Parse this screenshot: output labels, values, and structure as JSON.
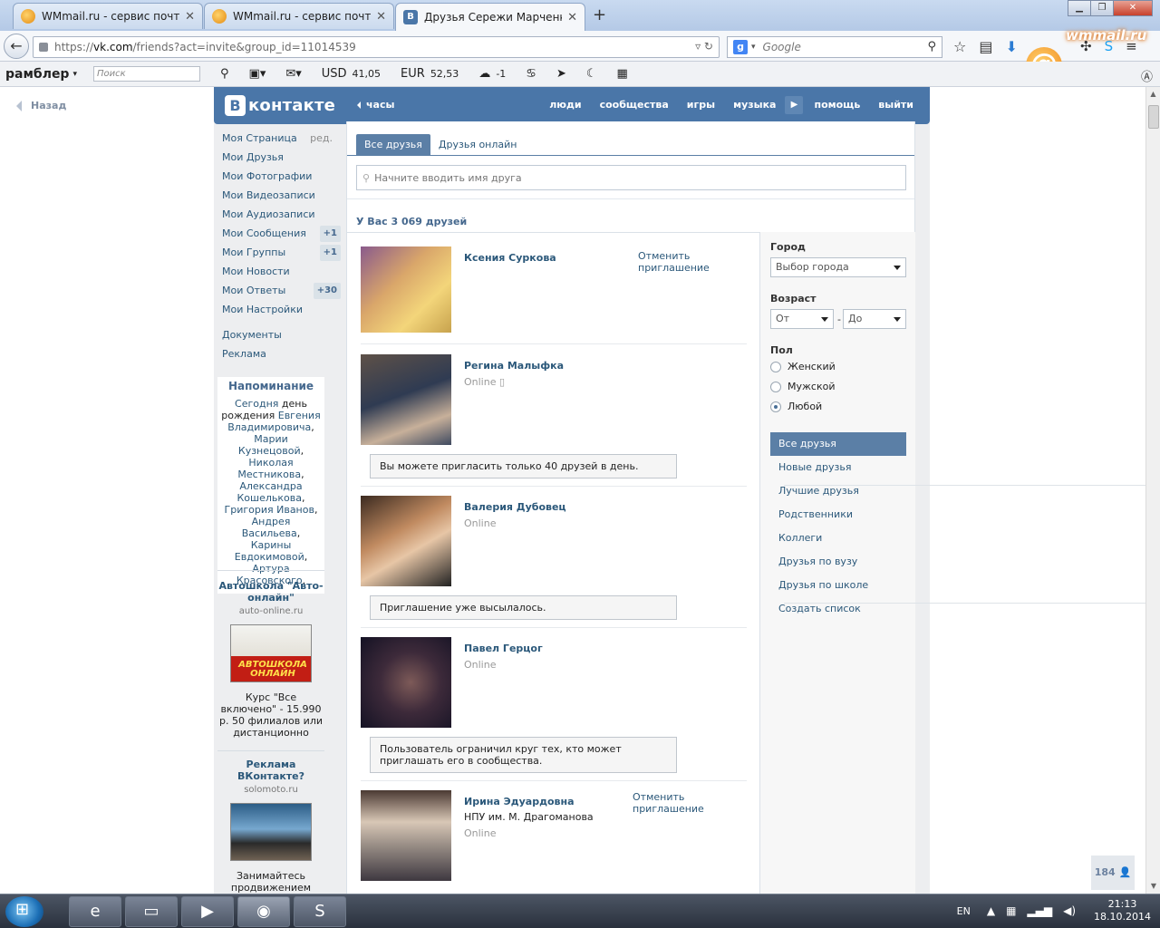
{
  "browser": {
    "tabs": [
      {
        "title": "WMmail.ru - сервис почт..."
      },
      {
        "title": "WMmail.ru - сервис почт..."
      },
      {
        "title": "Друзья Сережи Марченк..."
      }
    ],
    "url_prefix": "https://",
    "url_domain": "vk.com",
    "url_path": "/friends?act=invite&group_id=11014539",
    "search_placeholder": "Google",
    "wm_logo": "wmmail.ru"
  },
  "rambler": {
    "brand": "рамблер",
    "search_placeholder": "Поиск",
    "usd_label": "USD",
    "usd_value": "41,05",
    "eur_label": "EUR",
    "eur_value": "52,53",
    "weather": "-1"
  },
  "page": {
    "back_label": "Назад"
  },
  "vk": {
    "logo_letter": "В",
    "logo_text": "контакте",
    "back_label": "часы",
    "menu": [
      "люди",
      "сообщества",
      "игры",
      "музыка",
      "помощь",
      "выйти"
    ]
  },
  "sidebar": {
    "items": [
      {
        "label": "Моя Страница",
        "extra": "ред."
      },
      {
        "label": "Мои Друзья"
      },
      {
        "label": "Мои Фотографии"
      },
      {
        "label": "Мои Видеозаписи"
      },
      {
        "label": "Мои Аудиозаписи"
      },
      {
        "label": "Мои Сообщения",
        "count": "+1"
      },
      {
        "label": "Мои Группы",
        "count": "+1"
      },
      {
        "label": "Мои Новости"
      },
      {
        "label": "Мои Ответы",
        "count": "+30"
      },
      {
        "label": "Мои Настройки"
      }
    ],
    "extra_items": [
      "Документы",
      "Реклама"
    ],
    "reminder": {
      "title": "Напоминание",
      "today": "Сегодня",
      "text1": " день рождения ",
      "names": [
        "Евгения Владимировича",
        "Марии Кузнецовой",
        "Николая Местникова",
        "Александра Кошелькова",
        "Григория Иванов",
        "Андрея Васильева",
        "Карины Евдокимовой",
        "Артура Красовского"
      ]
    },
    "ads": [
      {
        "title": "Автошкола \"Авто-онлайн\"",
        "domain": "auto-online.ru",
        "text": "Курс \"Все включено\" - 15.990 р. 50 филиалов или дистанционно",
        "banner": "АВТОШКОЛА ОНЛАЙН"
      },
      {
        "title": "Реклама ВКонтакте?",
        "domain": "solomoto.ru",
        "text": "Занимайтесь продвижением своего"
      }
    ]
  },
  "main": {
    "tabs": [
      "Все друзья",
      "Друзья онлайн"
    ],
    "search_placeholder": "Начните вводить имя друга",
    "count_text": "У Вас 3 069 друзей",
    "friends": [
      {
        "name": "Ксения Суркова",
        "cancel": "Отменить приглашение",
        "status": "",
        "note": ""
      },
      {
        "name": "Регина Малыфка",
        "status": "Online",
        "note": "Вы можете пригласить только 40 друзей в день."
      },
      {
        "name": "Валерия Дубовец",
        "status": "Online",
        "note": "Приглашение уже высылалось."
      },
      {
        "name": "Павел Герцог",
        "status": "Online",
        "note": "Пользователь ограничил круг тех, кто может приглашать его в сообщества."
      },
      {
        "name": "Ирина Эдуардовна",
        "sub": "НПУ им. М. Драгоманова",
        "status": "Online",
        "cancel": "Отменить приглашение"
      }
    ]
  },
  "filter": {
    "city_label": "Город",
    "city_value": "Выбор города",
    "age_label": "Возраст",
    "age_from": "От",
    "age_to": "До",
    "sex_label": "Пол",
    "sex_options": [
      "Женский",
      "Мужской",
      "Любой"
    ],
    "sex_selected": "Любой",
    "lists1": [
      "Все друзья",
      "Новые друзья"
    ],
    "lists2": [
      "Лучшие друзья",
      "Родственники",
      "Коллеги",
      "Друзья по вузу",
      "Друзья по школе"
    ],
    "create": "Создать список"
  },
  "counter": "184",
  "taskbar": {
    "lang": "EN",
    "time": "21:13",
    "date": "18.10.2014"
  }
}
